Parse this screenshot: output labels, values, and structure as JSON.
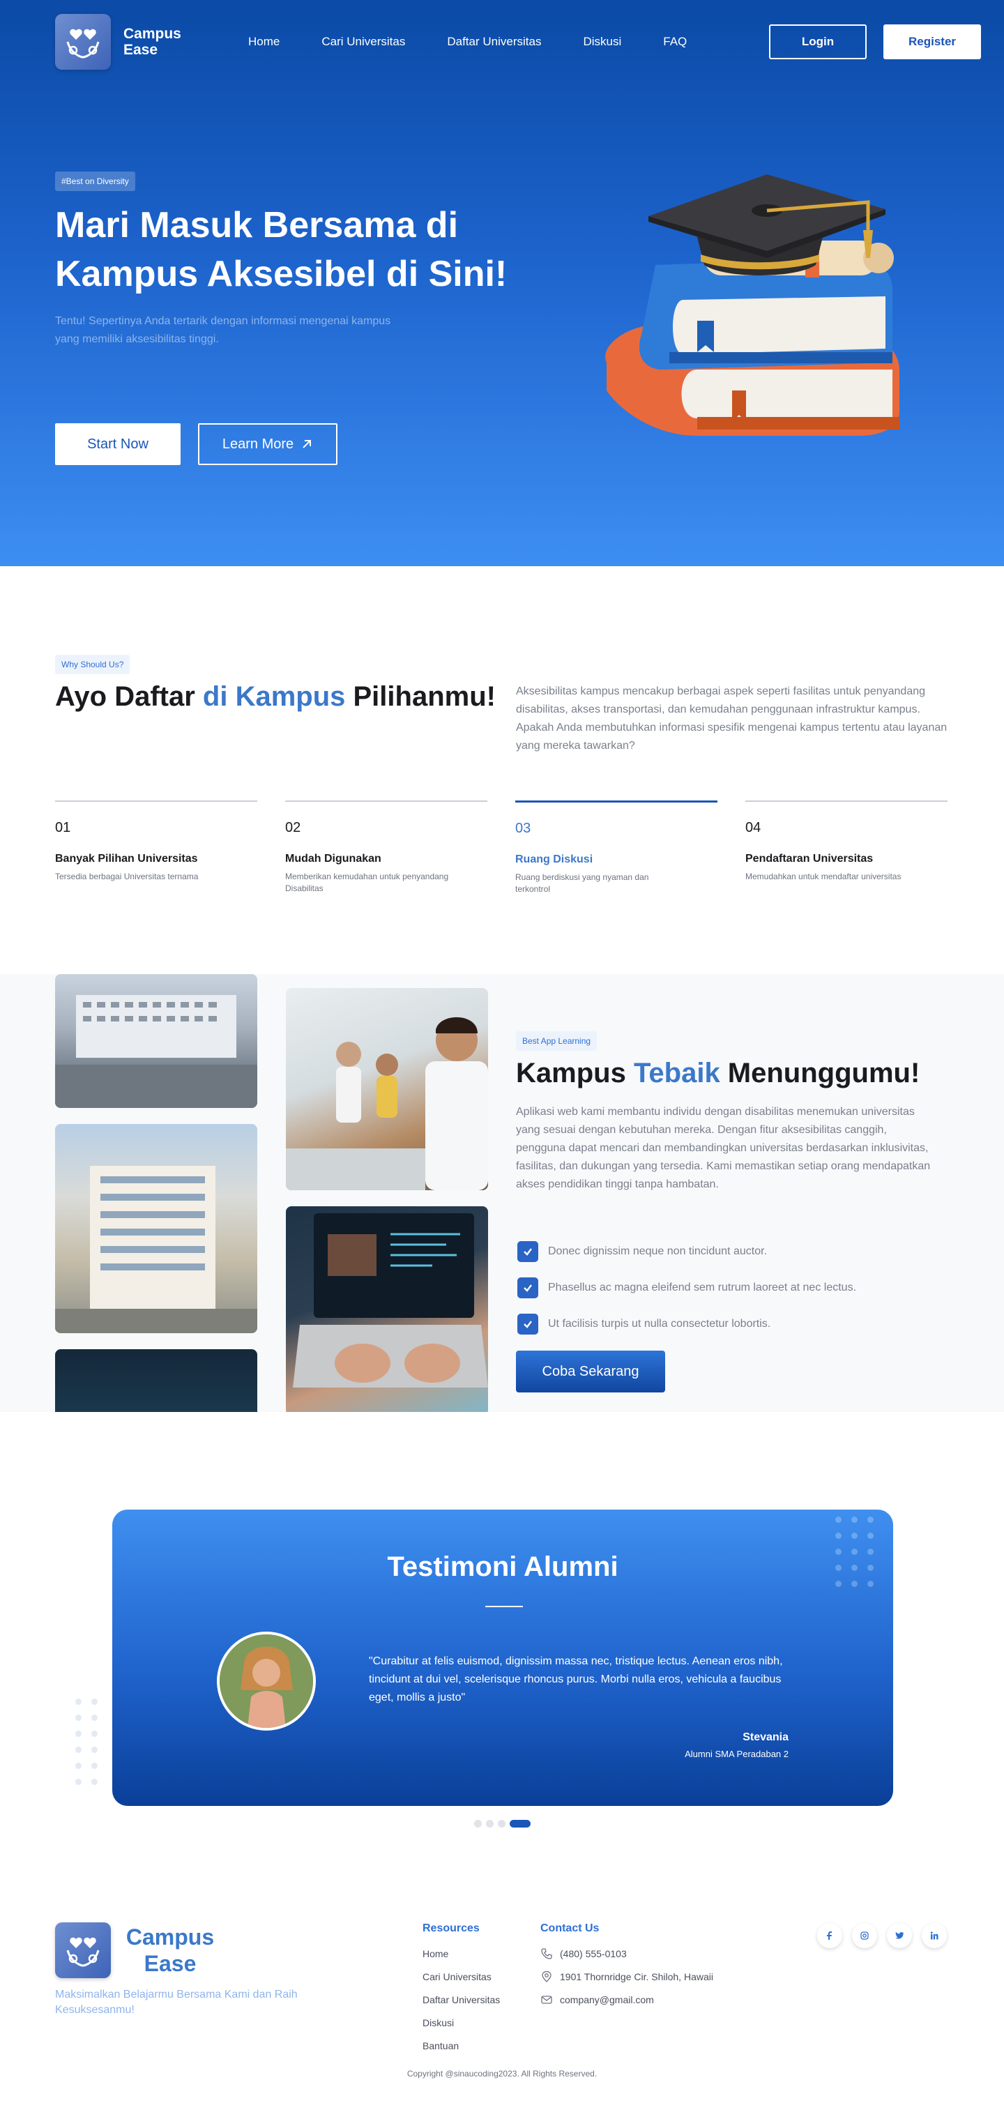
{
  "brand": {
    "name_line1": "Campus",
    "name_line2": "Ease"
  },
  "nav": {
    "links": [
      "Home",
      "Cari Universitas",
      "Daftar Universitas",
      "Diskusi",
      "FAQ"
    ],
    "login": "Login",
    "register": "Register"
  },
  "hero": {
    "badge": "#Best on Diversity",
    "title": "Mari Masuk Bersama di Kampus Aksesibel di Sini!",
    "subtitle": "Tentu! Sepertinya Anda tertarik dengan informasi mengenai kampus yang memiliki aksesibilitas tinggi.",
    "start": "Start  Now",
    "learn": "Learn More"
  },
  "why": {
    "badge": "Why Should Us?",
    "title_a": "Ayo Daftar ",
    "title_hl": "di Kampus",
    "title_b": " Pilihanmu!",
    "desc": "Aksesibilitas kampus mencakup berbagai aspek seperti fasilitas untuk penyandang disabilitas, akses transportasi, dan kemudahan penggunaan infrastruktur kampus. Apakah Anda membutuhkan informasi spesifik mengenai kampus tertentu atau layanan yang mereka tawarkan?",
    "steps": [
      {
        "num": "01",
        "title": "Banyak Pilihan Universitas",
        "text": "Tersedia berbagai Universitas ternama"
      },
      {
        "num": "02",
        "title": "Mudah Digunakan",
        "text": "Memberikan kemudahan untuk penyandang Disabilitas"
      },
      {
        "num": "03",
        "title": "Ruang Diskusi",
        "text": "Ruang berdiskusi yang nyaman dan terkontrol"
      },
      {
        "num": "04",
        "title": "Pendaftaran Universitas",
        "text": "Memudahkan untuk mendaftar universitas"
      }
    ]
  },
  "about": {
    "badge": "Best App Learning",
    "title_a": "Kampus ",
    "title_hl": "Tebaik",
    "title_b": " Menunggumu!",
    "desc": "Aplikasi web kami membantu individu dengan disabilitas menemukan universitas yang sesuai dengan kebutuhan mereka. Dengan fitur aksesibilitas canggih, pengguna dapat mencari dan membandingkan universitas berdasarkan inklusivitas, fasilitas, dan dukungan yang tersedia. Kami memastikan setiap orang mendapatkan akses pendidikan tinggi tanpa hambatan.",
    "checks": [
      "Donec dignissim neque non tincidunt auctor.",
      "Phasellus ac magna eleifend sem rutrum laoreet at nec lectus.",
      "Ut facilisis turpis ut nulla consectetur lobortis."
    ],
    "cta": "Coba Sekarang"
  },
  "testimonial": {
    "title": "Testimoni Alumni",
    "quote": "\"Curabitur at felis euismod, dignissim massa nec, tristique lectus. Aenean eros nibh, tincidunt at dui vel, scelerisque rhoncus purus. Morbi nulla eros, vehicula a faucibus eget, mollis a justo\"",
    "name": "Stevania",
    "role": "Alumni SMA Peradaban 2"
  },
  "footer": {
    "tagline": "Maksimalkan Belajarmu Bersama Kami dan Raih Kesuksesanmu!",
    "resources_title": "Resources",
    "resources": [
      "Home",
      "Cari Universitas",
      "Daftar Universitas",
      "Diskusi",
      "Bantuan"
    ],
    "contact_title": "Contact Us",
    "phone": "(480) 555-0103",
    "address": "1901 Thornridge Cir. Shiloh, Hawaii",
    "email": "company@gmail.com",
    "socials": [
      "f",
      "ig",
      "tw",
      "in"
    ],
    "copyright": "Copyright @sinaucoding2023. All Rights Reserved."
  },
  "colors": {
    "primary": "#1a56b7",
    "accent": "#3b78c9",
    "hero_top": "#0b4aa6",
    "hero_bottom": "#3d8ef3"
  }
}
